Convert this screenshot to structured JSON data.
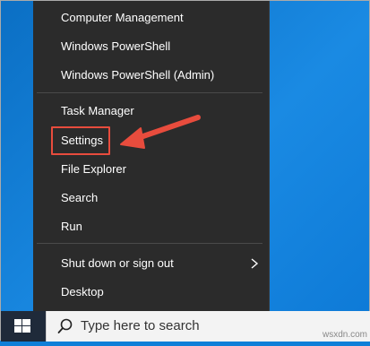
{
  "menu": {
    "items": [
      {
        "label": "Computer Management"
      },
      {
        "label": "Windows PowerShell"
      },
      {
        "label": "Windows PowerShell (Admin)"
      },
      {
        "label": "Task Manager"
      },
      {
        "label": "Settings"
      },
      {
        "label": "File Explorer"
      },
      {
        "label": "Search"
      },
      {
        "label": "Run"
      },
      {
        "label": "Shut down or sign out"
      },
      {
        "label": "Desktop"
      }
    ]
  },
  "taskbar": {
    "search_placeholder": "Type here to search"
  },
  "annotation": {
    "highlight_color": "#e84c3d",
    "arrow_color": "#e84c3d"
  },
  "watermark": "wsxdn.com",
  "icons": {
    "start": "windows-logo-icon",
    "search": "magnifier-icon",
    "submenu": "chevron-right-icon"
  }
}
